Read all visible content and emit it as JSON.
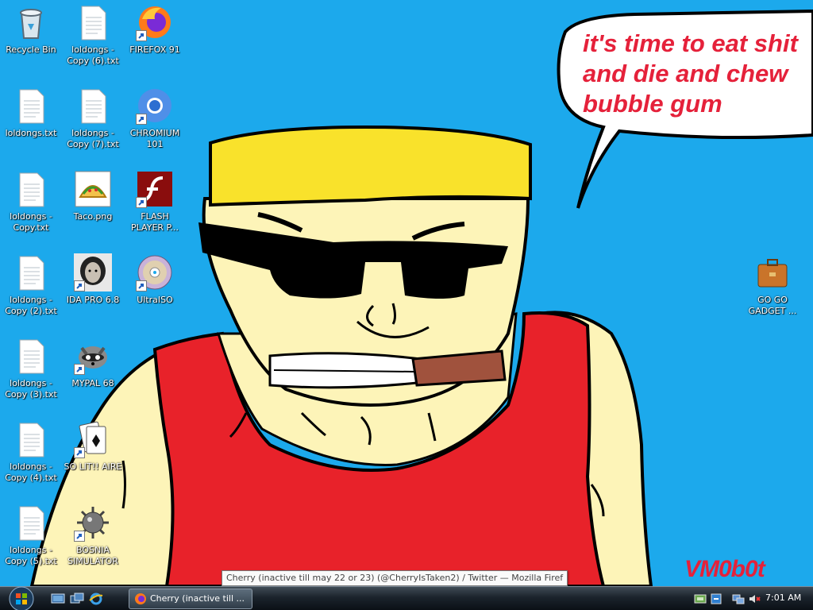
{
  "desktop": {
    "icons": [
      {
        "label": "Recycle Bin",
        "icon": "recycle-bin-icon"
      },
      {
        "label": "loldongs -\nCopy (6).txt",
        "icon": "text-file-icon"
      },
      {
        "label": "FIREFOX 91",
        "icon": "firefox-icon"
      },
      {
        "label": "loldongs.txt",
        "icon": "text-file-icon"
      },
      {
        "label": "loldongs -\nCopy (7).txt",
        "icon": "text-file-icon"
      },
      {
        "label": "CHROMIUM\n101",
        "icon": "chromium-icon"
      },
      {
        "label": "loldongs -\nCopy.txt",
        "icon": "text-file-icon"
      },
      {
        "label": "Taco.png",
        "icon": "taco-image-icon"
      },
      {
        "label": "FLASH\nPLAYER P...",
        "icon": "flash-player-icon"
      },
      {
        "label": "loldongs -\nCopy (2).txt",
        "icon": "text-file-icon"
      },
      {
        "label": "IDA PRO 6.8",
        "icon": "ida-pro-icon"
      },
      {
        "label": "UltraISO",
        "icon": "disc-icon"
      },
      {
        "label": "loldongs -\nCopy (3).txt",
        "icon": "text-file-icon"
      },
      {
        "label": "MYPAL 68",
        "icon": "raccoon-icon"
      },
      {
        "label": "loldongs -\nCopy (4).txt",
        "icon": "text-file-icon"
      },
      {
        "label": "SO LIT!! AIRE",
        "icon": "playing-cards-icon"
      },
      {
        "label": "loldongs -\nCopy (5).txt",
        "icon": "text-file-icon"
      },
      {
        "label": "BOSNIA\nSIMULATOR",
        "icon": "mine-icon"
      },
      {
        "label": "GO GO\nGADGET ...",
        "icon": "briefcase-icon"
      }
    ]
  },
  "wallpaper": {
    "speech_text": "it's time to eat shit\nand die and chew\nbubble gum",
    "signature": "VM0b0t"
  },
  "tooltip": {
    "text": "Cherry (inactive till may 22 or 23) (@CherryIsTaken2) / Twitter — Mozilla Firef"
  },
  "taskbar": {
    "task_button_label": "Cherry (inactive till ...",
    "clock": "7:01 AM"
  },
  "colors": {
    "desktop_bg": "#1ca9ec",
    "speech_red": "#e5213a"
  }
}
